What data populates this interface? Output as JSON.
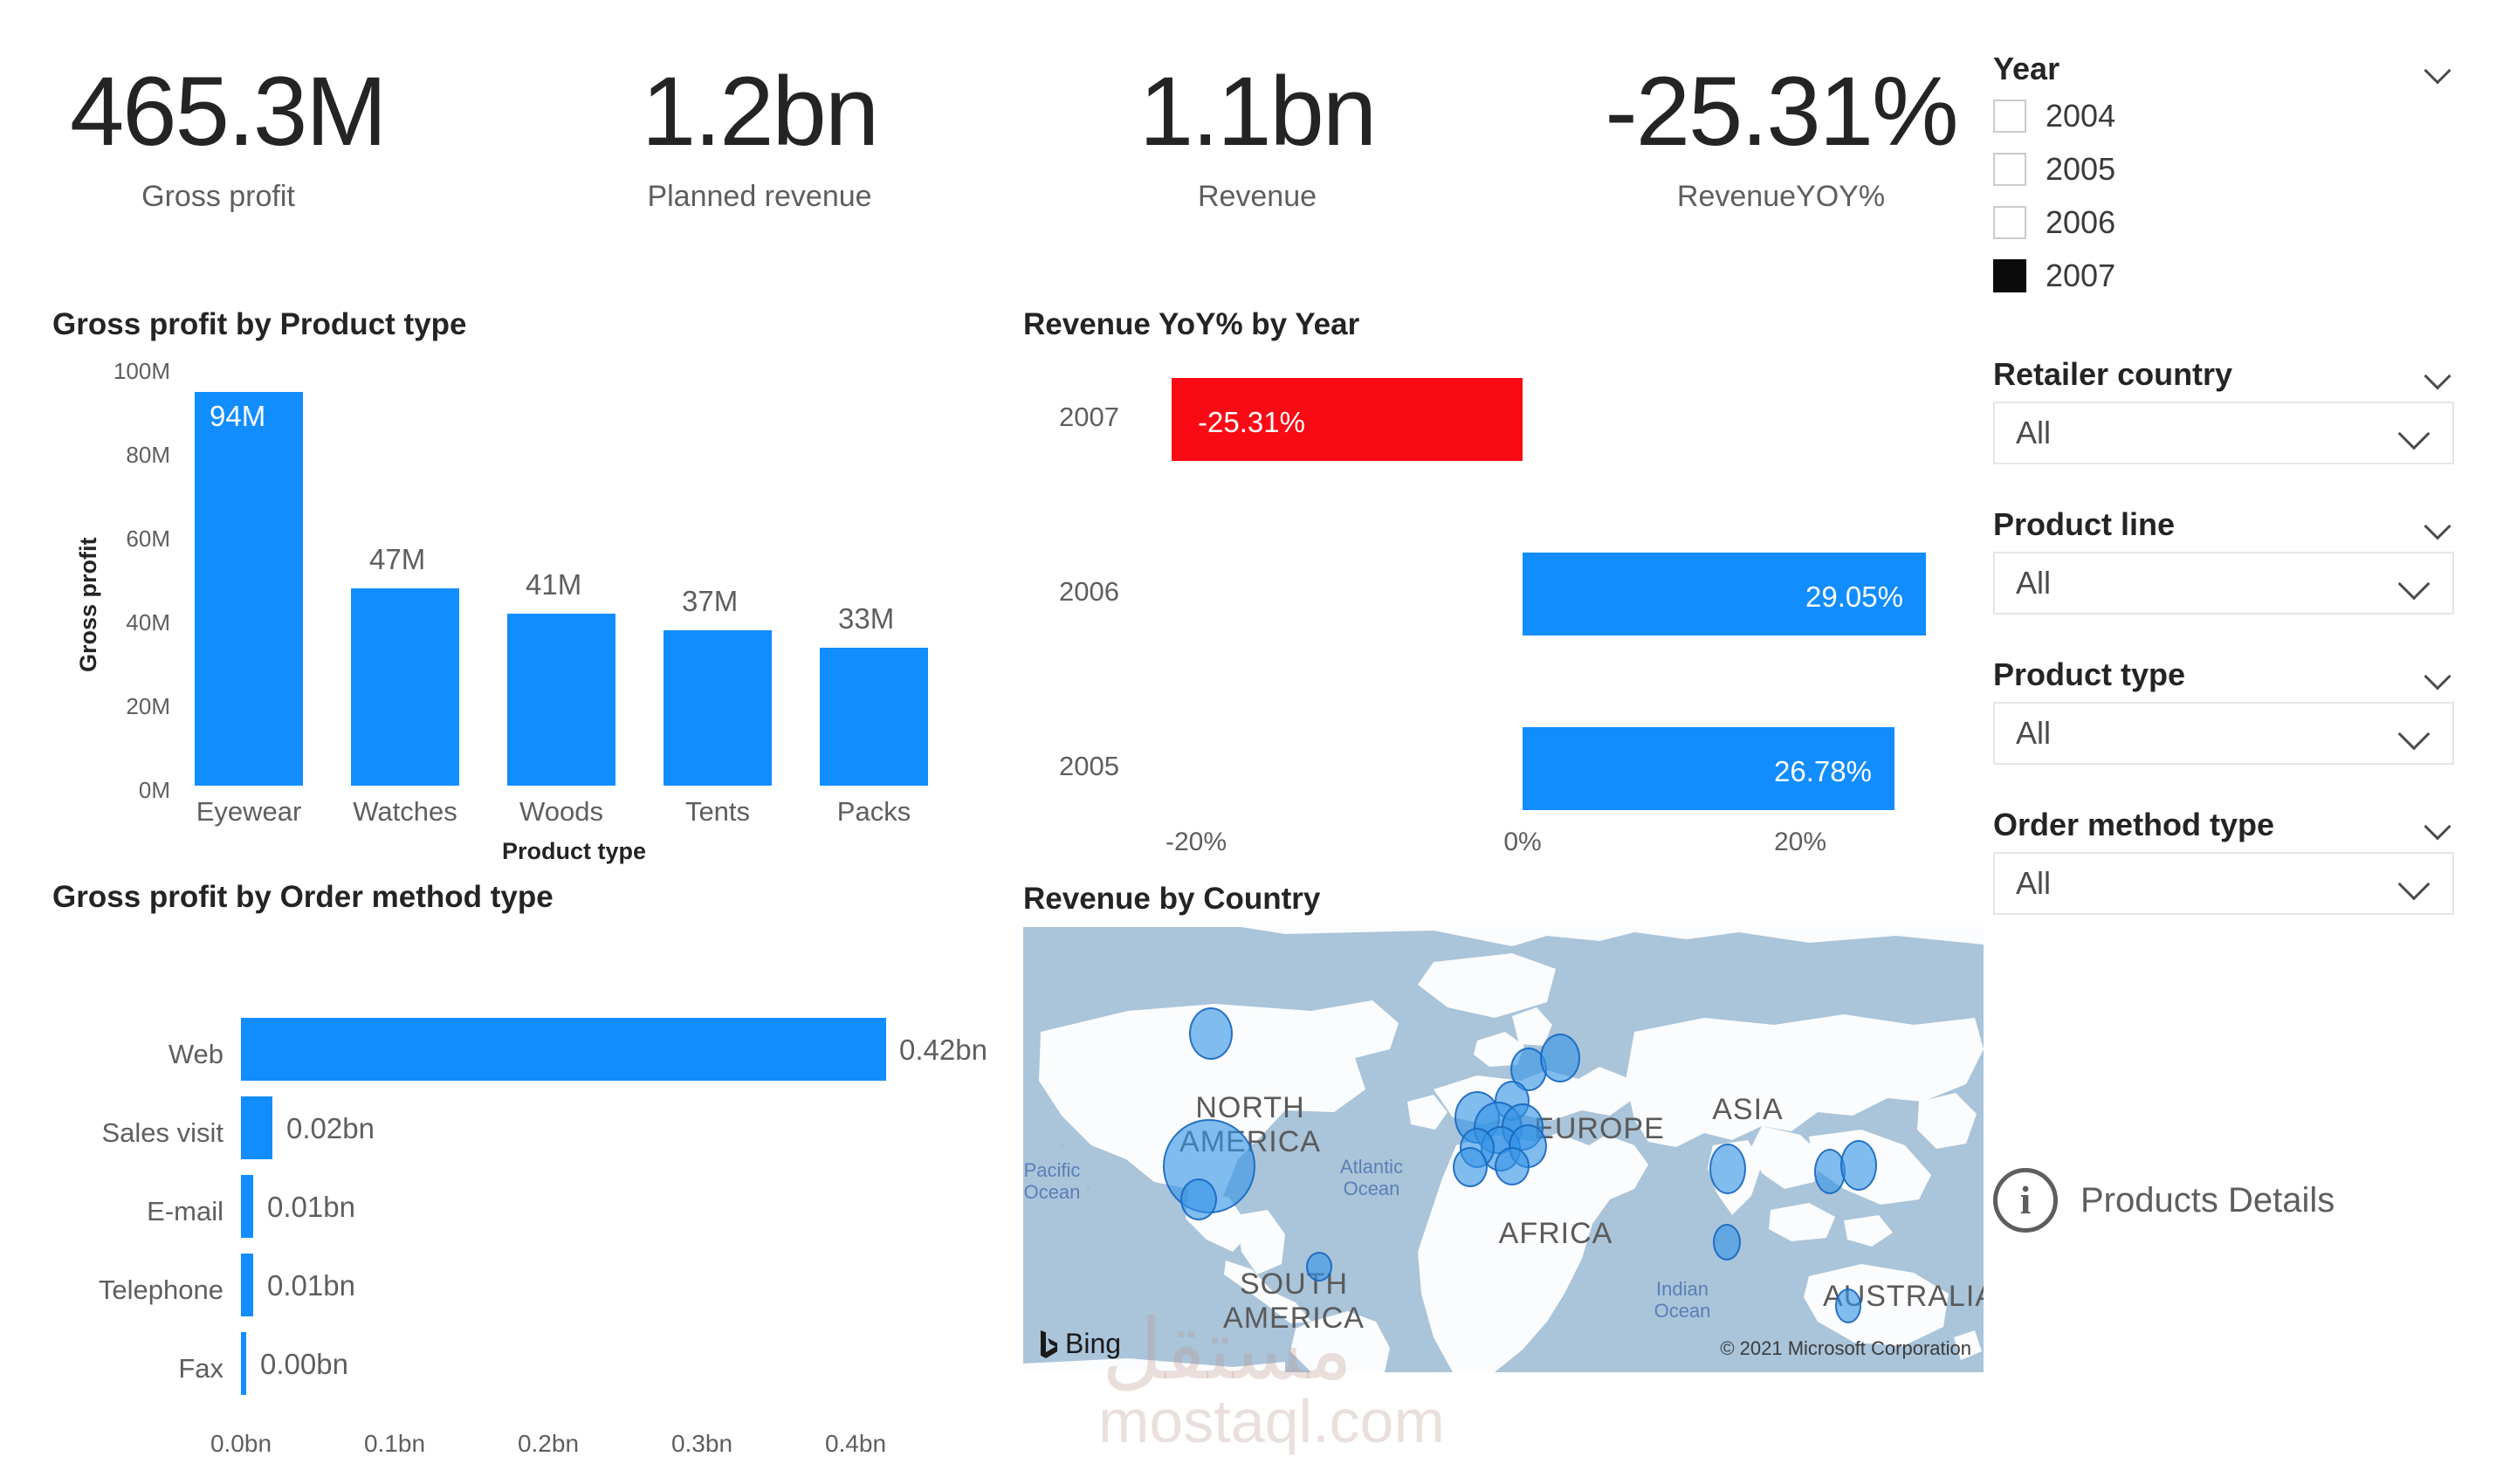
{
  "kpis": [
    {
      "value": "465.3M",
      "label": "Gross profit"
    },
    {
      "value": "1.2bn",
      "label": "Planned revenue"
    },
    {
      "value": "1.1bn",
      "label": "Revenue"
    },
    {
      "value": "-25.31%",
      "label": "RevenueYOY%"
    }
  ],
  "colors": {
    "positive_bar": "#118DFE",
    "negative_bar": "#FA0A14",
    "text_primary": "#252423",
    "text_secondary": "#605e5c",
    "map_water": "#aac4da",
    "map_land": "#ffffff",
    "bubble": "#3694e6"
  },
  "chart_data": [
    {
      "type": "bar",
      "title": "Gross profit by Product type",
      "xlabel": "Product type",
      "ylabel": "Gross profit",
      "categories": [
        "Eyewear",
        "Watches",
        "Woods",
        "Tents",
        "Packs"
      ],
      "values": [
        94,
        47,
        41,
        37,
        33
      ],
      "data_labels": [
        "94M",
        "47M",
        "41M",
        "37M",
        "33M"
      ],
      "ytick_labels": [
        "100M",
        "80M",
        "60M",
        "40M",
        "20M",
        "0M"
      ],
      "ytick_values": [
        100,
        80,
        60,
        40,
        20,
        0
      ],
      "ylim": [
        0,
        100
      ],
      "unit": "M",
      "grid": false,
      "legend": "none",
      "orientation": "vertical"
    },
    {
      "type": "bar",
      "title": "Gross profit by Order method type",
      "xlabel": "",
      "ylabel": "",
      "categories": [
        "Web",
        "Sales visit",
        "E-mail",
        "Telephone",
        "Fax"
      ],
      "values": [
        0.42,
        0.02,
        0.01,
        0.01,
        0.0
      ],
      "data_labels": [
        "0.42bn",
        "0.02bn",
        "0.01bn",
        "0.01bn",
        "0.00bn"
      ],
      "xtick_labels": [
        "0.0bn",
        "0.1bn",
        "0.2bn",
        "0.3bn",
        "0.4bn"
      ],
      "xtick_values": [
        0.0,
        0.1,
        0.2,
        0.3,
        0.4
      ],
      "xlim": [
        0,
        0.45
      ],
      "unit": "bn",
      "grid": false,
      "legend": "none",
      "orientation": "horizontal"
    },
    {
      "type": "bar",
      "title": "Revenue YoY% by Year",
      "xlabel": "",
      "ylabel": "",
      "categories": [
        "2007",
        "2006",
        "2005"
      ],
      "values": [
        -25.31,
        29.05,
        26.78
      ],
      "data_labels": [
        "-25.31%",
        "29.05%",
        "26.78%"
      ],
      "bar_colors": [
        "#FA0A14",
        "#118DFE",
        "#118DFE"
      ],
      "xtick_labels": [
        "-20%",
        "0%",
        "20%"
      ],
      "xtick_values": [
        -20,
        0,
        20
      ],
      "xlim": [
        -30,
        32
      ],
      "unit": "%",
      "grid": false,
      "legend": "none",
      "orientation": "horizontal"
    }
  ],
  "map": {
    "title": "Revenue by Country",
    "provider": "Bing",
    "credit": "© 2021 Microsoft Corporation",
    "continent_labels": [
      "NORTH AMERICA",
      "EUROPE",
      "ASIA",
      "AFRICA",
      "SOUTH AMERICA",
      "AUSTRALIA"
    ],
    "ocean_labels": [
      "Pacific Ocean",
      "Atlantic Ocean",
      "Indian Ocean"
    ]
  },
  "watermark": {
    "arabic": "مستقل",
    "latin": "mostaql.com"
  },
  "rail": {
    "year_slicer": {
      "title": "Year",
      "items": [
        {
          "label": "2004",
          "checked": false
        },
        {
          "label": "2005",
          "checked": false
        },
        {
          "label": "2006",
          "checked": false
        },
        {
          "label": "2007",
          "checked": true
        }
      ]
    },
    "dropdowns": [
      {
        "title": "Retailer country",
        "value": "All"
      },
      {
        "title": "Product line",
        "value": "All"
      },
      {
        "title": "Product type",
        "value": "All"
      },
      {
        "title": "Order method type",
        "value": "All"
      }
    ],
    "nav_button": {
      "label": "Products Details",
      "icon": "info-icon"
    }
  }
}
